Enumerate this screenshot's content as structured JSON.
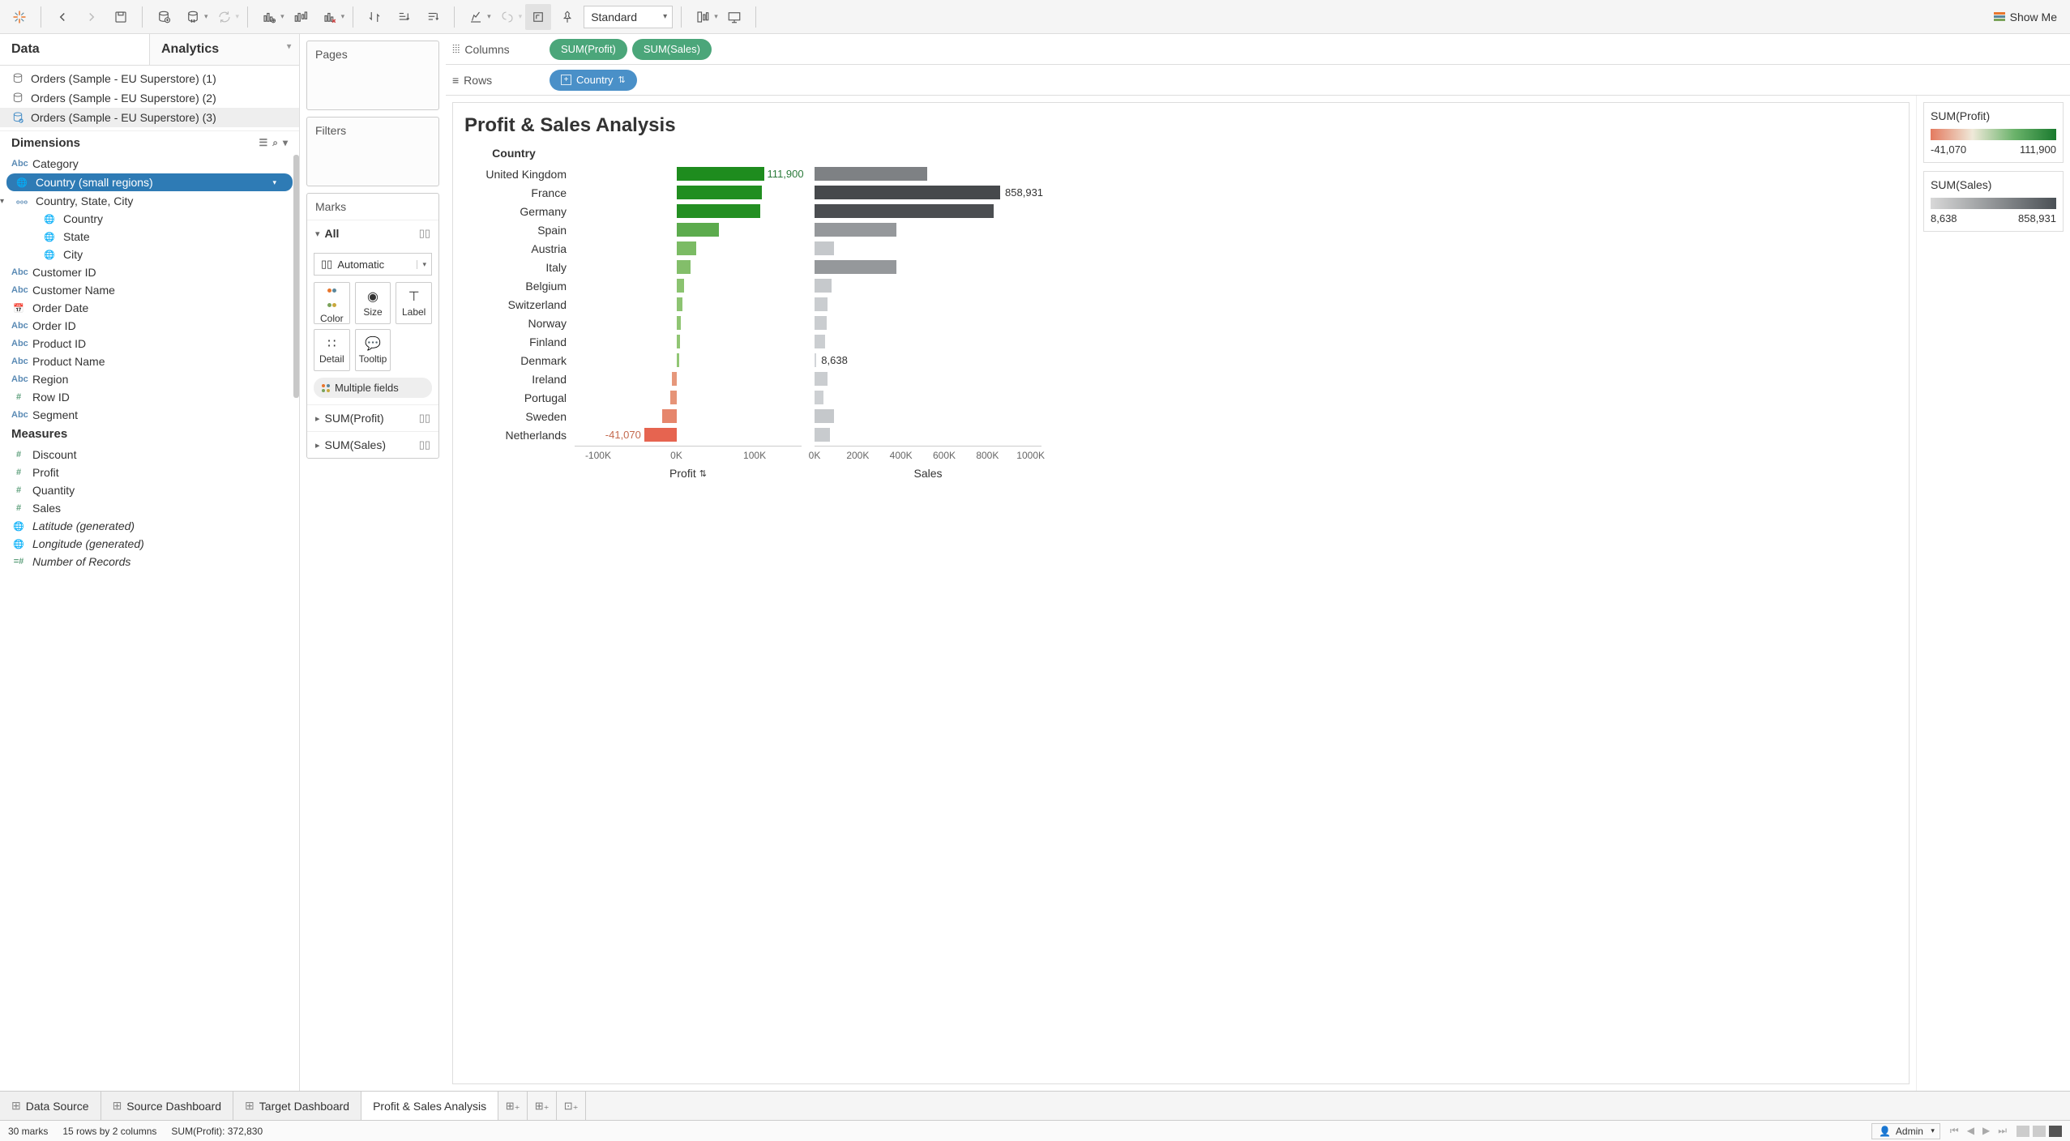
{
  "toolbar": {
    "fit_mode": "Standard",
    "showme": "Show Me"
  },
  "data_pane": {
    "tab_data": "Data",
    "tab_analytics": "Analytics",
    "datasources": [
      "Orders (Sample - EU Superstore) (1)",
      "Orders (Sample - EU Superstore) (2)",
      "Orders (Sample - EU Superstore) (3)"
    ],
    "dimensions_label": "Dimensions",
    "dimensions": {
      "category": "Category",
      "country_small": "Country (small regions)",
      "hierarchy": "Country, State, City",
      "country": "Country",
      "state": "State",
      "city": "City",
      "customer_id": "Customer ID",
      "customer_name": "Customer Name",
      "order_date": "Order Date",
      "order_id": "Order ID",
      "product_id": "Product ID",
      "product_name": "Product Name",
      "region": "Region",
      "row_id": "Row ID",
      "segment": "Segment"
    },
    "measures_label": "Measures",
    "measures": {
      "discount": "Discount",
      "profit": "Profit",
      "quantity": "Quantity",
      "sales": "Sales",
      "latitude": "Latitude (generated)",
      "longitude": "Longitude (generated)",
      "num_records": "Number of Records"
    }
  },
  "shelves": {
    "pages": "Pages",
    "filters": "Filters",
    "marks": "Marks",
    "all": "All",
    "mark_type": "Automatic",
    "color": "Color",
    "size": "Size",
    "label": "Label",
    "detail": "Detail",
    "tooltip": "Tooltip",
    "multiple_fields": "Multiple fields",
    "sum_profit": "SUM(Profit)",
    "sum_sales": "SUM(Sales)"
  },
  "cols_rows": {
    "columns": "Columns",
    "rows": "Rows",
    "pill_profit": "SUM(Profit)",
    "pill_sales": "SUM(Sales)",
    "pill_country": "Country"
  },
  "viz": {
    "title": "Profit & Sales Analysis",
    "country_header": "Country",
    "profit_axis": "Profit",
    "sales_axis": "Sales"
  },
  "chart_data": {
    "type": "bar",
    "categories": [
      "United Kingdom",
      "France",
      "Germany",
      "Spain",
      "Austria",
      "Italy",
      "Belgium",
      "Switzerland",
      "Norway",
      "Finland",
      "Denmark",
      "Ireland",
      "Portugal",
      "Sweden",
      "Netherlands"
    ],
    "series": [
      {
        "name": "Profit",
        "values": [
          111900,
          109000,
          107000,
          54000,
          25000,
          18000,
          10000,
          8000,
          6000,
          5000,
          4000,
          -6000,
          -8000,
          -18000,
          -41070
        ],
        "label_country": {
          "United Kingdom": "111,900",
          "Netherlands": "-41,070"
        }
      },
      {
        "name": "Sales",
        "values": [
          520000,
          858931,
          830000,
          380000,
          90000,
          380000,
          80000,
          60000,
          55000,
          50000,
          8638,
          60000,
          40000,
          90000,
          70000
        ],
        "label_country": {
          "France": "858,931",
          "Denmark": "8,638"
        }
      }
    ],
    "profit_ticks": [
      "-100K",
      "0K",
      "100K"
    ],
    "sales_ticks": [
      "0K",
      "200K",
      "400K",
      "600K",
      "800K",
      "1000K"
    ],
    "profit_range": [
      -130000,
      160000
    ],
    "sales_range": [
      0,
      1050000
    ]
  },
  "legends": {
    "profit_title": "SUM(Profit)",
    "profit_min": "-41,070",
    "profit_max": "111,900",
    "sales_title": "SUM(Sales)",
    "sales_min": "8,638",
    "sales_max": "858,931"
  },
  "worksheet_tabs": {
    "data_source": "Data Source",
    "source_dash": "Source Dashboard",
    "target_dash": "Target Dashboard",
    "active": "Profit & Sales Analysis"
  },
  "status": {
    "marks": "30 marks",
    "rows_cols": "15 rows by 2 columns",
    "sum_profit": "SUM(Profit): 372,830",
    "user": "Admin"
  }
}
